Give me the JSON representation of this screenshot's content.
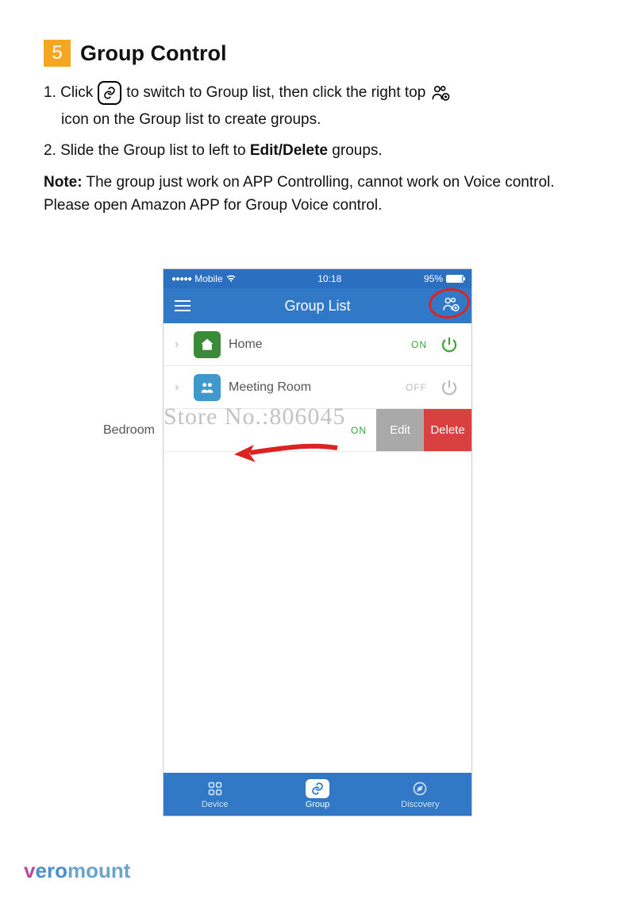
{
  "section": {
    "number": "5",
    "title": "Group Control"
  },
  "instructions": {
    "step1_a": "1. Click",
    "step1_b": "to switch to Group list, then click the right top",
    "step1_c": "icon on the Group list to create groups.",
    "step2_a": "2. Slide the Group list to left to ",
    "step2_bold": "Edit/Delete",
    "step2_b": " groups.",
    "note_label": "Note:",
    "note_body": " The group just work on APP Controlling, cannot work on Voice control. Please open Amazon APP for Group Voice control."
  },
  "phone": {
    "status": {
      "carrier": "Mobile",
      "time": "10:18",
      "battery": "95%"
    },
    "navbar": {
      "title": "Group List"
    },
    "rows": [
      {
        "name": "Home",
        "state": "ON",
        "on": true
      },
      {
        "name": "Meeting Room",
        "state": "OFF",
        "on": false
      },
      {
        "name": "Bedroom",
        "state": "ON",
        "on": true,
        "swiped": true
      }
    ],
    "swipe": {
      "edit": "Edit",
      "delete": "Delete"
    },
    "tabs": {
      "device": "Device",
      "group": "Group",
      "discovery": "Discovery"
    }
  },
  "watermark": "Store No.:806045",
  "branding": {
    "vero": "vero",
    "mount": "mount"
  }
}
